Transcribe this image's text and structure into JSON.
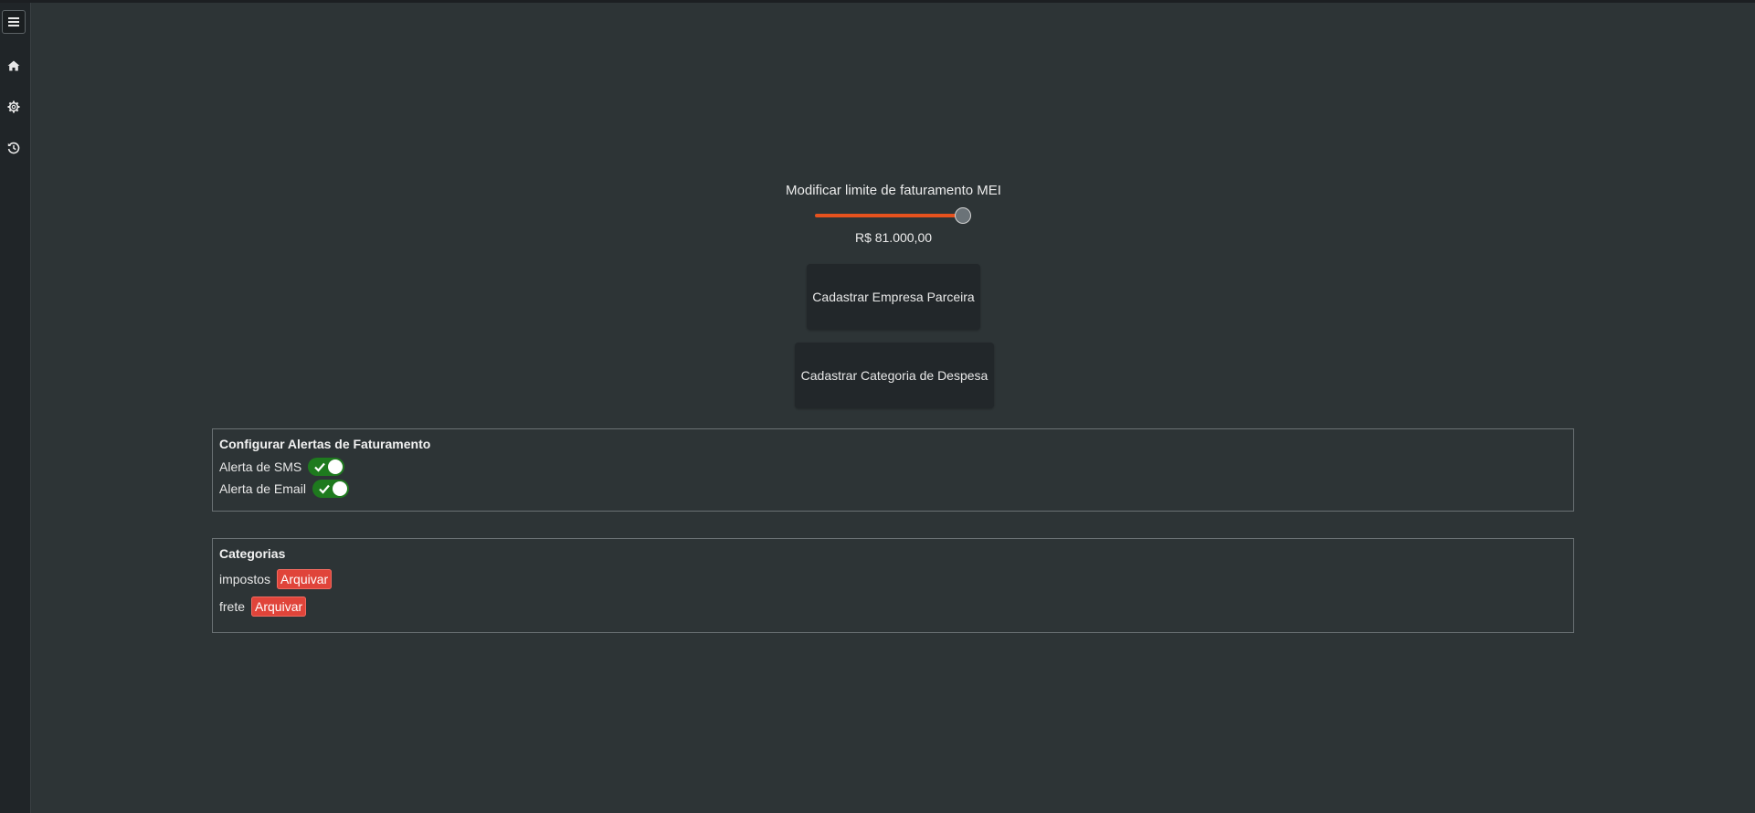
{
  "sidebar": {
    "icons": [
      "menu-icon",
      "home-icon",
      "gear-icon",
      "history-icon"
    ]
  },
  "limit": {
    "label": "Modificar limite de faturamento MEI",
    "value_text": "R$ 81.000,00",
    "slider_fraction": 1.0
  },
  "buttons": {
    "empresa": "Cadastrar Empresa Parceira",
    "categoria": "Cadastrar Categoria de Despesa"
  },
  "alerts": {
    "title": "Configurar Alertas de Faturamento",
    "items": [
      {
        "label": "Alerta de SMS",
        "enabled": true
      },
      {
        "label": "Alerta de Email",
        "enabled": true
      }
    ]
  },
  "categories": {
    "title": "Categorias",
    "archive_label": "Arquivar",
    "items": [
      {
        "name": "impostos"
      },
      {
        "name": "frete"
      }
    ]
  },
  "colors": {
    "background": "#2d3436",
    "slider_accent": "#e6521e",
    "toggle_on": "#1e7a1e",
    "archive_button": "#e0443a"
  }
}
